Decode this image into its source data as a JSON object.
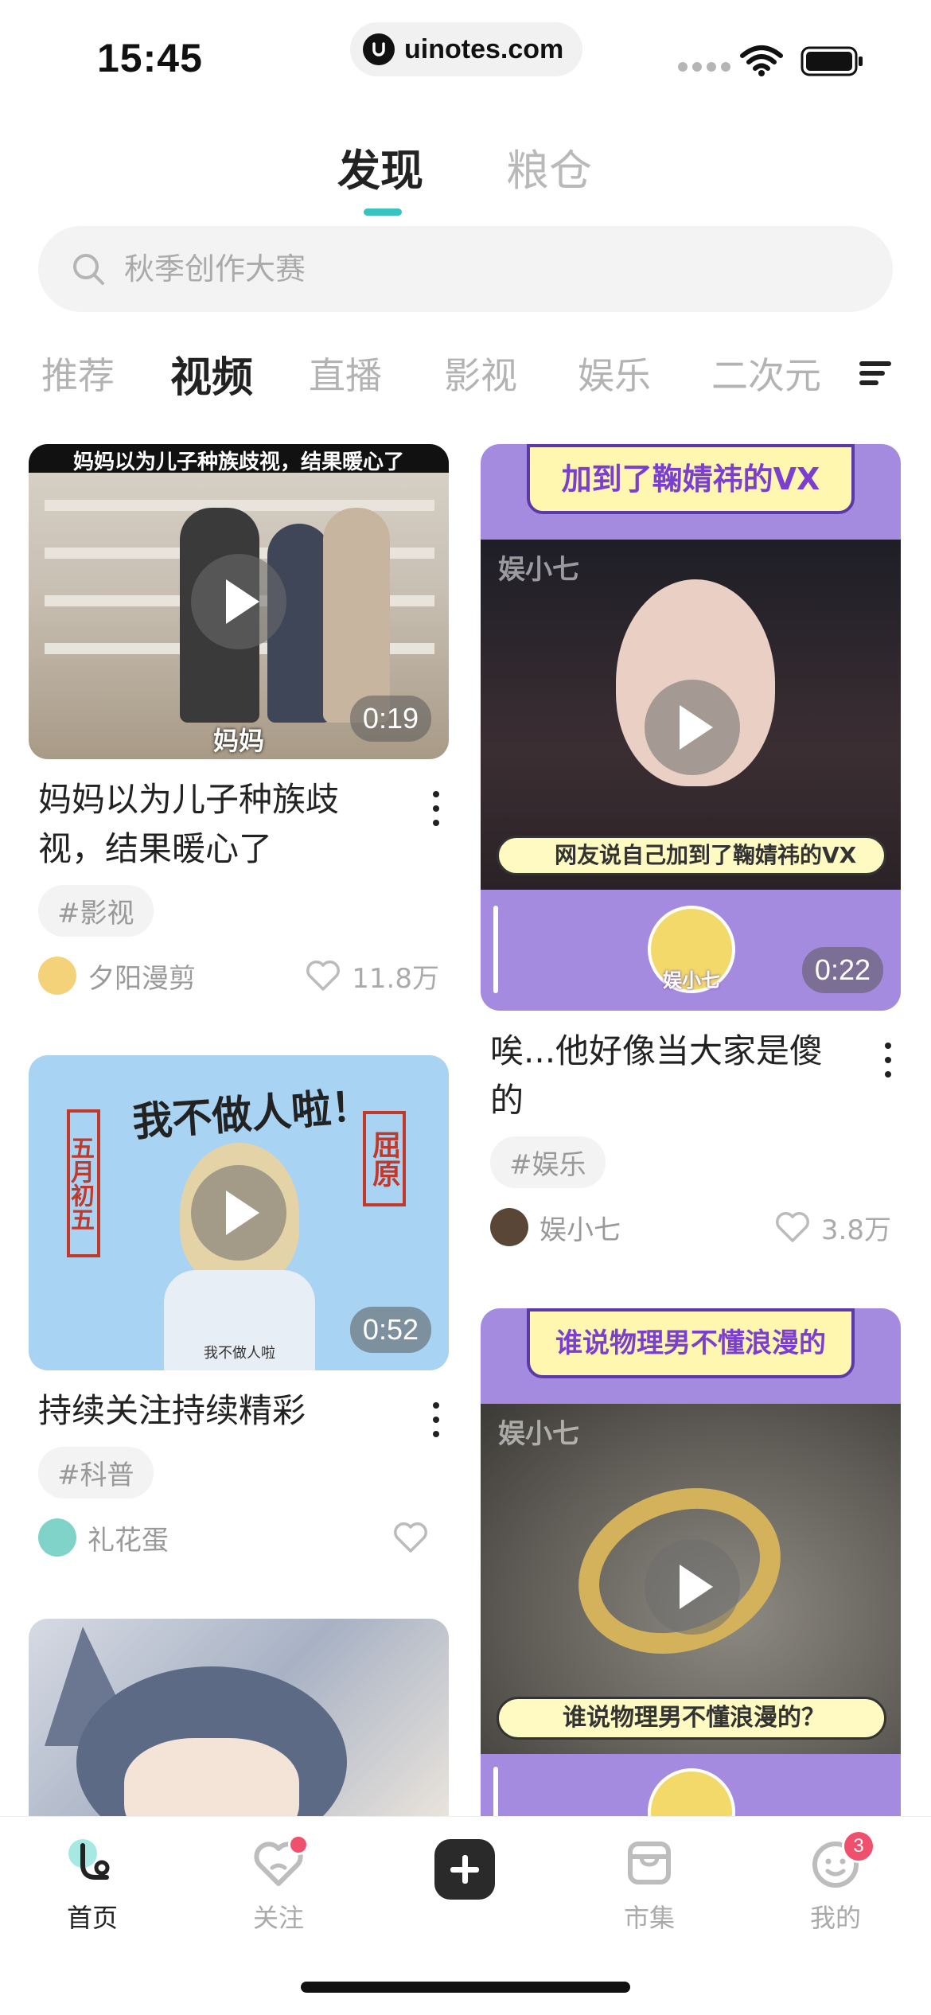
{
  "status": {
    "time": "15:45",
    "url": "uinotes.com"
  },
  "top_tabs": [
    {
      "label": "发现",
      "active": true
    },
    {
      "label": "粮仓",
      "active": false
    }
  ],
  "search": {
    "placeholder": "秋季创作大赛"
  },
  "categories": [
    "推荐",
    "视频",
    "直播",
    "影视",
    "娱乐",
    "二次元"
  ],
  "active_category": "视频",
  "cards": [
    {
      "thumb_top_text": "妈妈以为儿子种族歧视，结果暖心了",
      "thumb_bottom_text": "妈妈",
      "duration": "0:19",
      "title": "妈妈以为儿子种族歧视，结果暖心了",
      "tag": "#影视",
      "author": "夕阳漫剪",
      "likes": "11.8万"
    },
    {
      "thumb_top_text": "加到了鞠婧祎的VX",
      "thumb_watermark": "娱小七",
      "thumb_banner": "网友说自己加到了鞠婧祎的VX",
      "thumb_mascot": "娱小七",
      "duration": "0:22",
      "title": "唉...他好像当大家是傻的",
      "tag": "#娱乐",
      "author": "娱小七",
      "likes": "3.8万"
    },
    {
      "thumb_top_text": "我不做人啦！",
      "thumb_left_seal": "五月初五",
      "thumb_right_seal": "屈原",
      "thumb_bottom_text": "我不做人啦",
      "duration": "0:52",
      "title": "持续关注持续精彩",
      "tag": "#科普",
      "author": "礼花蛋",
      "likes": ""
    },
    {
      "thumb_top_text": "谁说物理男不懂浪漫的",
      "thumb_watermark": "娱小七",
      "thumb_banner": "谁说物理男不懂浪漫的？"
    }
  ],
  "bottom_nav": [
    {
      "label": "首页",
      "active": true
    },
    {
      "label": "关注",
      "active": false
    },
    {
      "label": "市集",
      "active": false
    },
    {
      "label": "我的",
      "active": false,
      "badge": "3"
    }
  ],
  "colors": {
    "accent": "#39c3bf",
    "badge": "#f0506e",
    "purple": "#a58be0"
  }
}
